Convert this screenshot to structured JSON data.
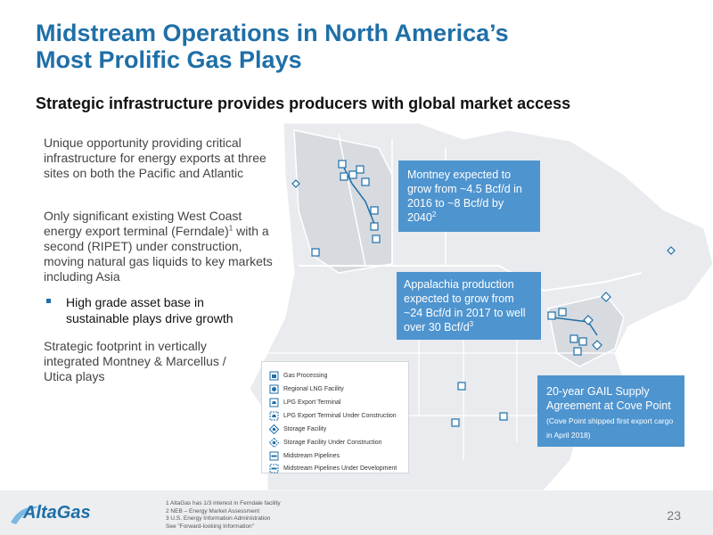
{
  "header": {
    "title_line1": "Midstream Operations in North America’s",
    "title_line2": "Most Prolific Gas Plays",
    "subtitle": "Strategic infrastructure provides producers with global market access"
  },
  "left": {
    "para1": "Unique opportunity providing critical infrastructure for energy exports at three sites on both the Pacific and Atlantic",
    "para2_a": "Only significant existing West Coast energy export terminal (Ferndale)",
    "para2_sup": "1",
    "para2_b": " with a second (RIPET) under construction, moving natural gas liquids to key markets including Asia",
    "bullet": "High grade asset base in sustainable plays drive growth",
    "para3": "Strategic footprint in vertically integrated Montney & Marcellus / Utica plays"
  },
  "callouts": {
    "montney": {
      "text": "Montney expected to grow from ~4.5 Bcf/d in 2016 to ~8 Bcf/d by 2040",
      "sup": "2"
    },
    "appalachia": {
      "text": "Appalachia production expected to grow from ~24 Bcf/d in 2017 to well over 30 Bcf/d",
      "sup": "3"
    },
    "gail": {
      "text": "20-year GAIL Supply Agreement at Cove Point",
      "small": " (Cove Point shipped first export cargo in April 2018)"
    }
  },
  "legend": {
    "items": [
      {
        "label": "Gas Processing",
        "icon": "gas-processing-icon"
      },
      {
        "label": "Regional LNG Facility",
        "icon": "regional-lng-icon"
      },
      {
        "label": "LPG Export Terminal",
        "icon": "lpg-export-icon"
      },
      {
        "label": "LPG Export Terminal Under Construction",
        "icon": "lpg-export-construction-icon"
      },
      {
        "label": "Storage Facility",
        "icon": "storage-facility-icon"
      },
      {
        "label": "Storage Facility Under Construction",
        "icon": "storage-construction-icon"
      },
      {
        "label": "Midstream Pipelines",
        "icon": "midstream-pipeline-icon"
      },
      {
        "label": "Midstream Pipelines Under Development",
        "icon": "pipeline-development-icon"
      }
    ]
  },
  "footer": {
    "logo": "AltaGas",
    "footnotes": [
      "1 AltaGas has 1/3 interest in Ferndale facility",
      "2 NEB – Energy Market Assessment",
      "3 U.S. Energy Information Administration",
      "See \"Forward-looking Information\""
    ],
    "page_number": "23"
  },
  "colors": {
    "accent": "#1f6fa8",
    "callout": "#4e94cf",
    "land": "#e9ebee",
    "highlight_region": "#d9dde2"
  }
}
